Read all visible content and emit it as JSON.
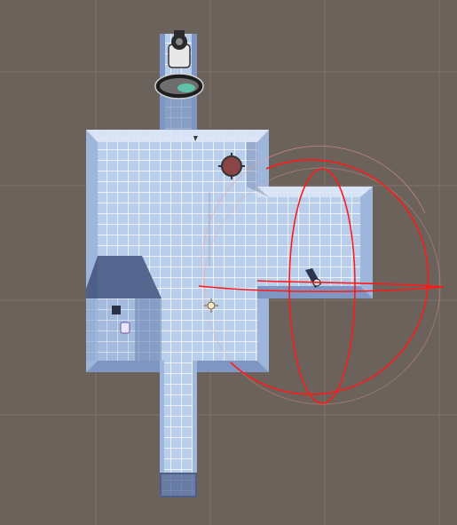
{
  "scene": {
    "background_color": "#6b635b",
    "grid_line_color": "#7c756e",
    "floor_color": "#b8ceea",
    "floor_tile_line_color": "#ffffff",
    "wall_shade_color": "#6f86b3",
    "wall_top_color": "#dce7f6",
    "shadow_color": "#5a6b94",
    "gizmo_color": "#ff1a1a",
    "objects": [
      {
        "name": "camera",
        "icon": "camera-icon"
      },
      {
        "name": "room-floor",
        "icon": "floor-tiles"
      },
      {
        "name": "light-probe",
        "icon": "sun-icon"
      },
      {
        "name": "reflection-probe",
        "icon": "reflection-probe-icon"
      },
      {
        "name": "audio-source",
        "icon": "audio-icon"
      },
      {
        "name": "player",
        "icon": "player-icon"
      },
      {
        "name": "light-gizmo",
        "icon": "point-light-icon"
      }
    ]
  }
}
